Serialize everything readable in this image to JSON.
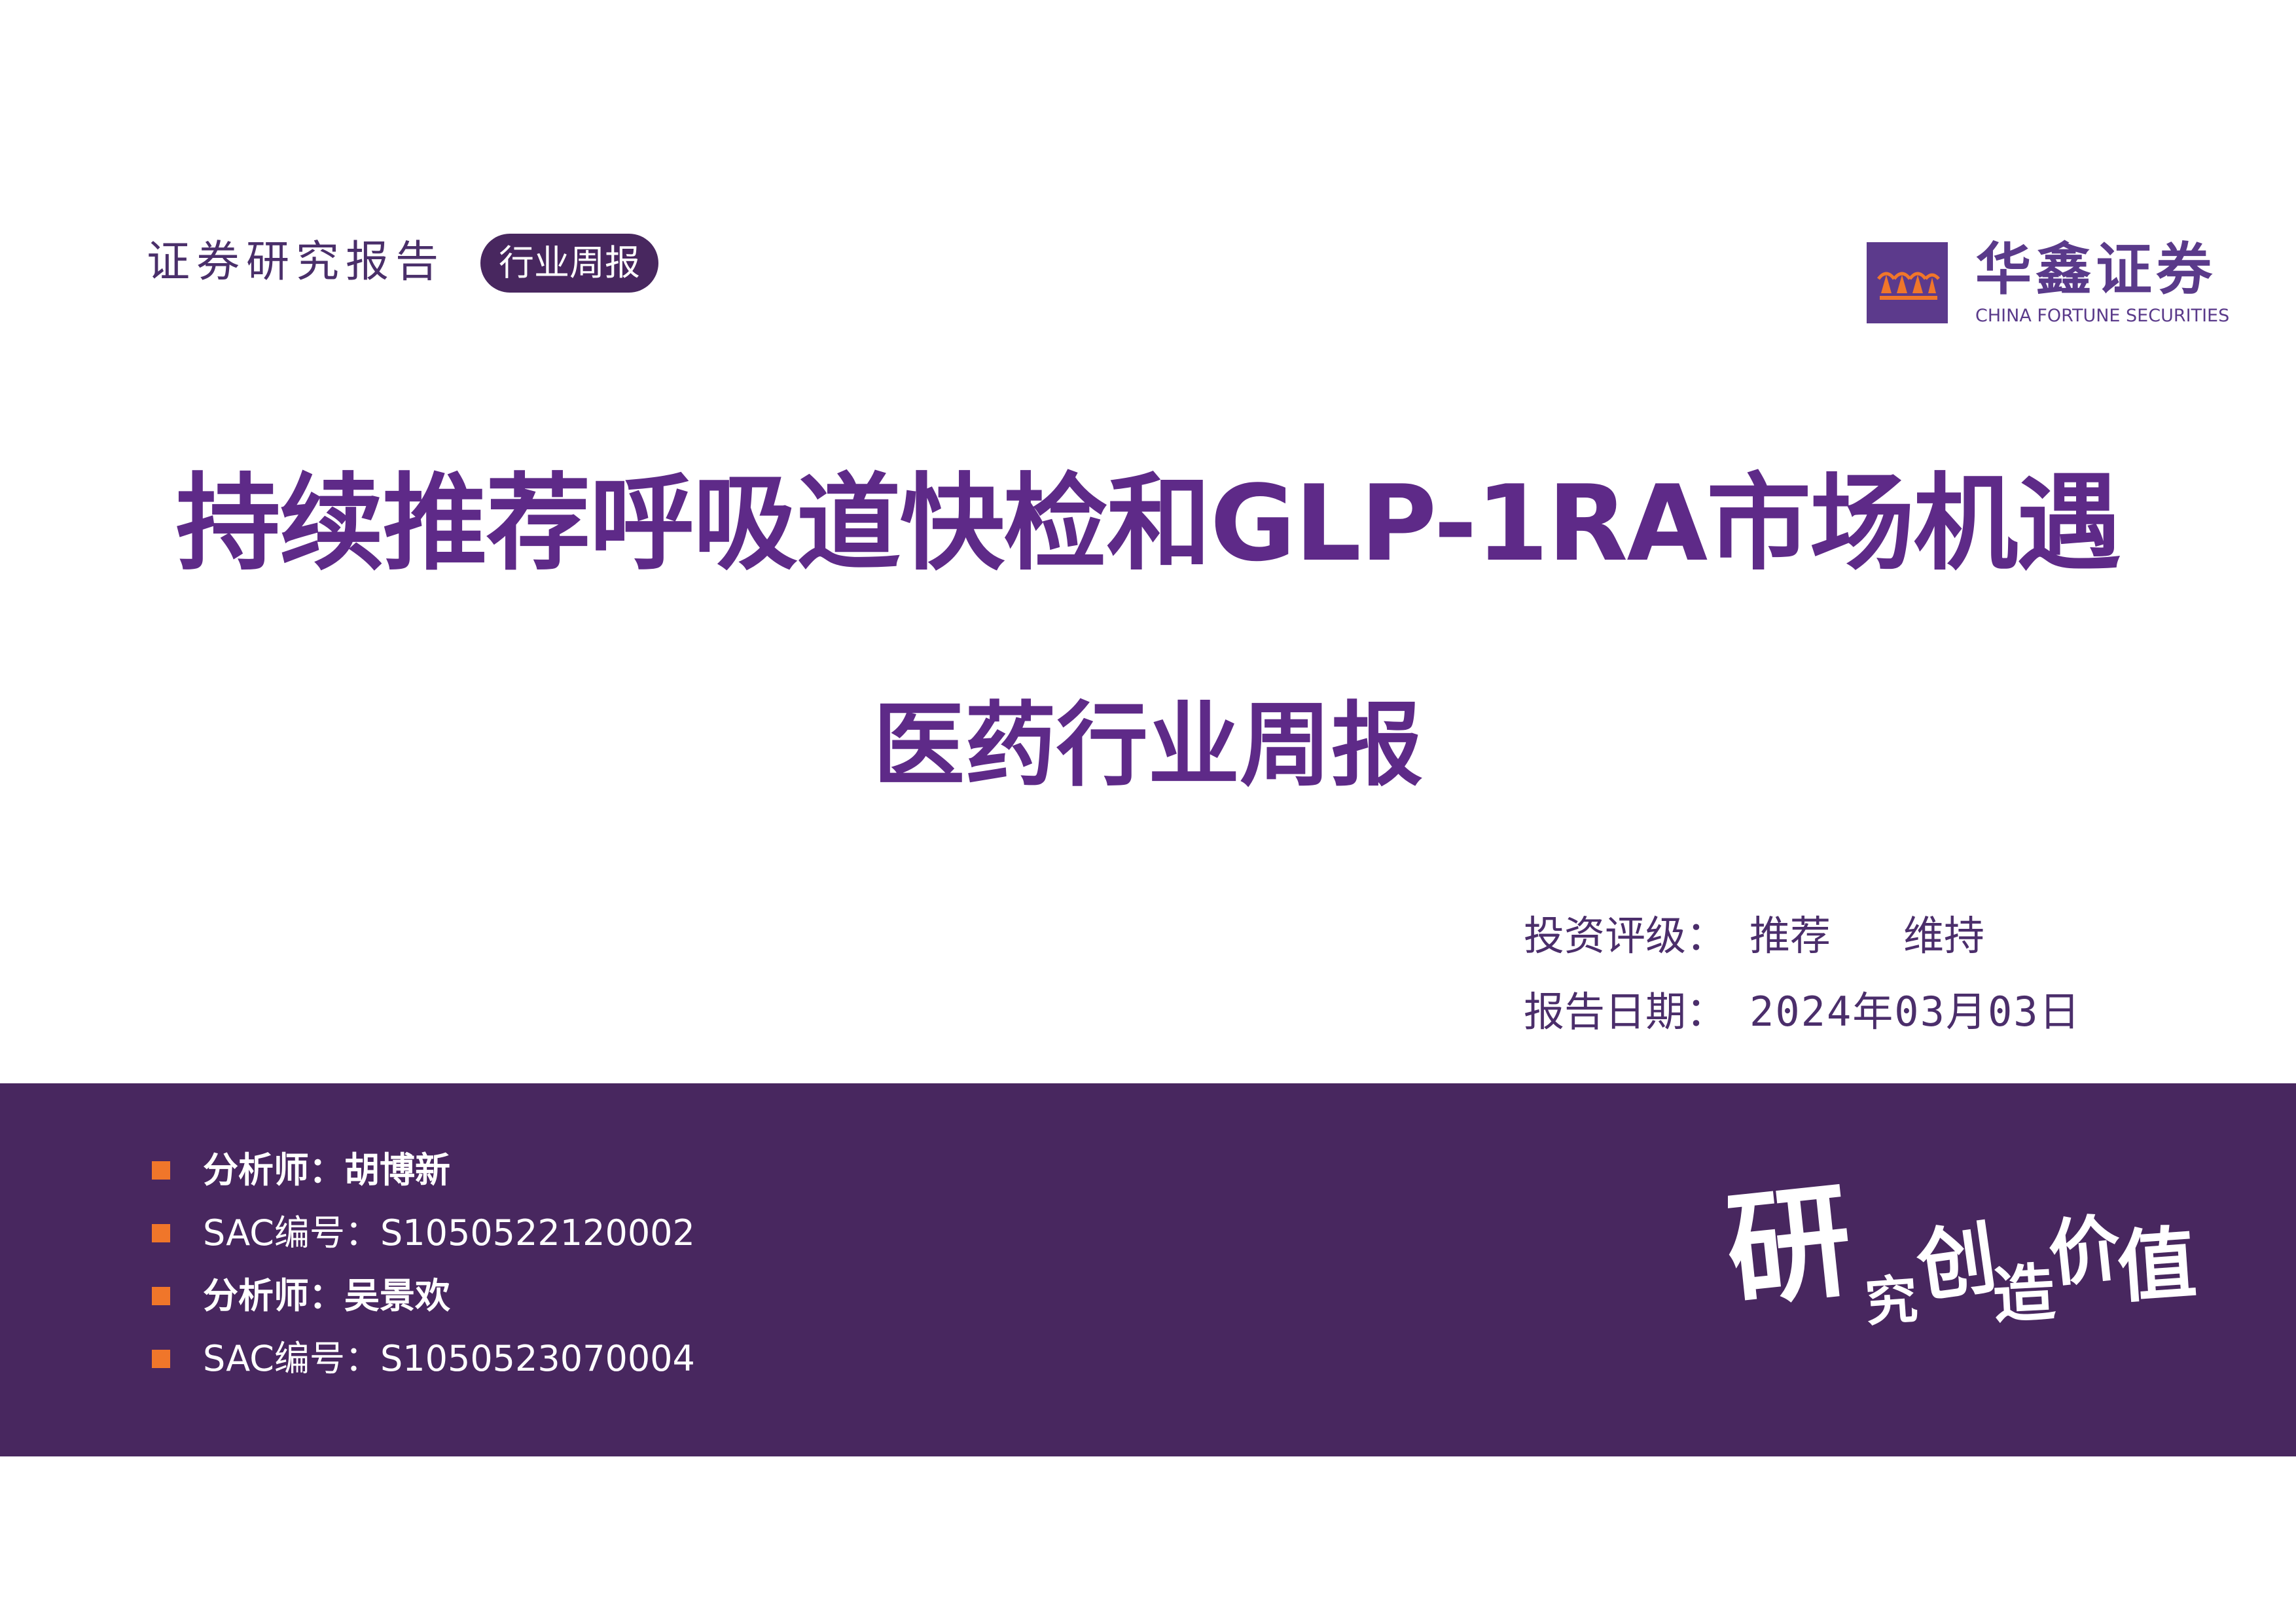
{
  "header": {
    "report_type": "证券研究报告",
    "tag": "行业周报"
  },
  "logo": {
    "name_cn": "华鑫证券",
    "name_en": "CHINA FORTUNE SECURITIES",
    "icon": "logo-mark-icon",
    "color": "#5c3a8c",
    "accent": "#f0762a"
  },
  "title": "持续推荐呼吸道快检和GLP-1RA市场机遇",
  "subtitle": "医药行业周报",
  "rating": {
    "label": "投资评级：",
    "value1": "推荐",
    "value2": "维持"
  },
  "date": {
    "label": "报告日期：",
    "value": "2024年03月03日"
  },
  "analysts": [
    {
      "text": "分析师：胡博新"
    },
    {
      "text": "SAC编号：S1050522120002"
    },
    {
      "text": "分析师：吴景欢"
    },
    {
      "text": "SAC编号：S1050523070004"
    }
  ],
  "slogan": "研究创造价值",
  "colors": {
    "purple_band": "#48275f",
    "title_purple": "#5e2a88",
    "bullet_orange": "#f0762a"
  }
}
